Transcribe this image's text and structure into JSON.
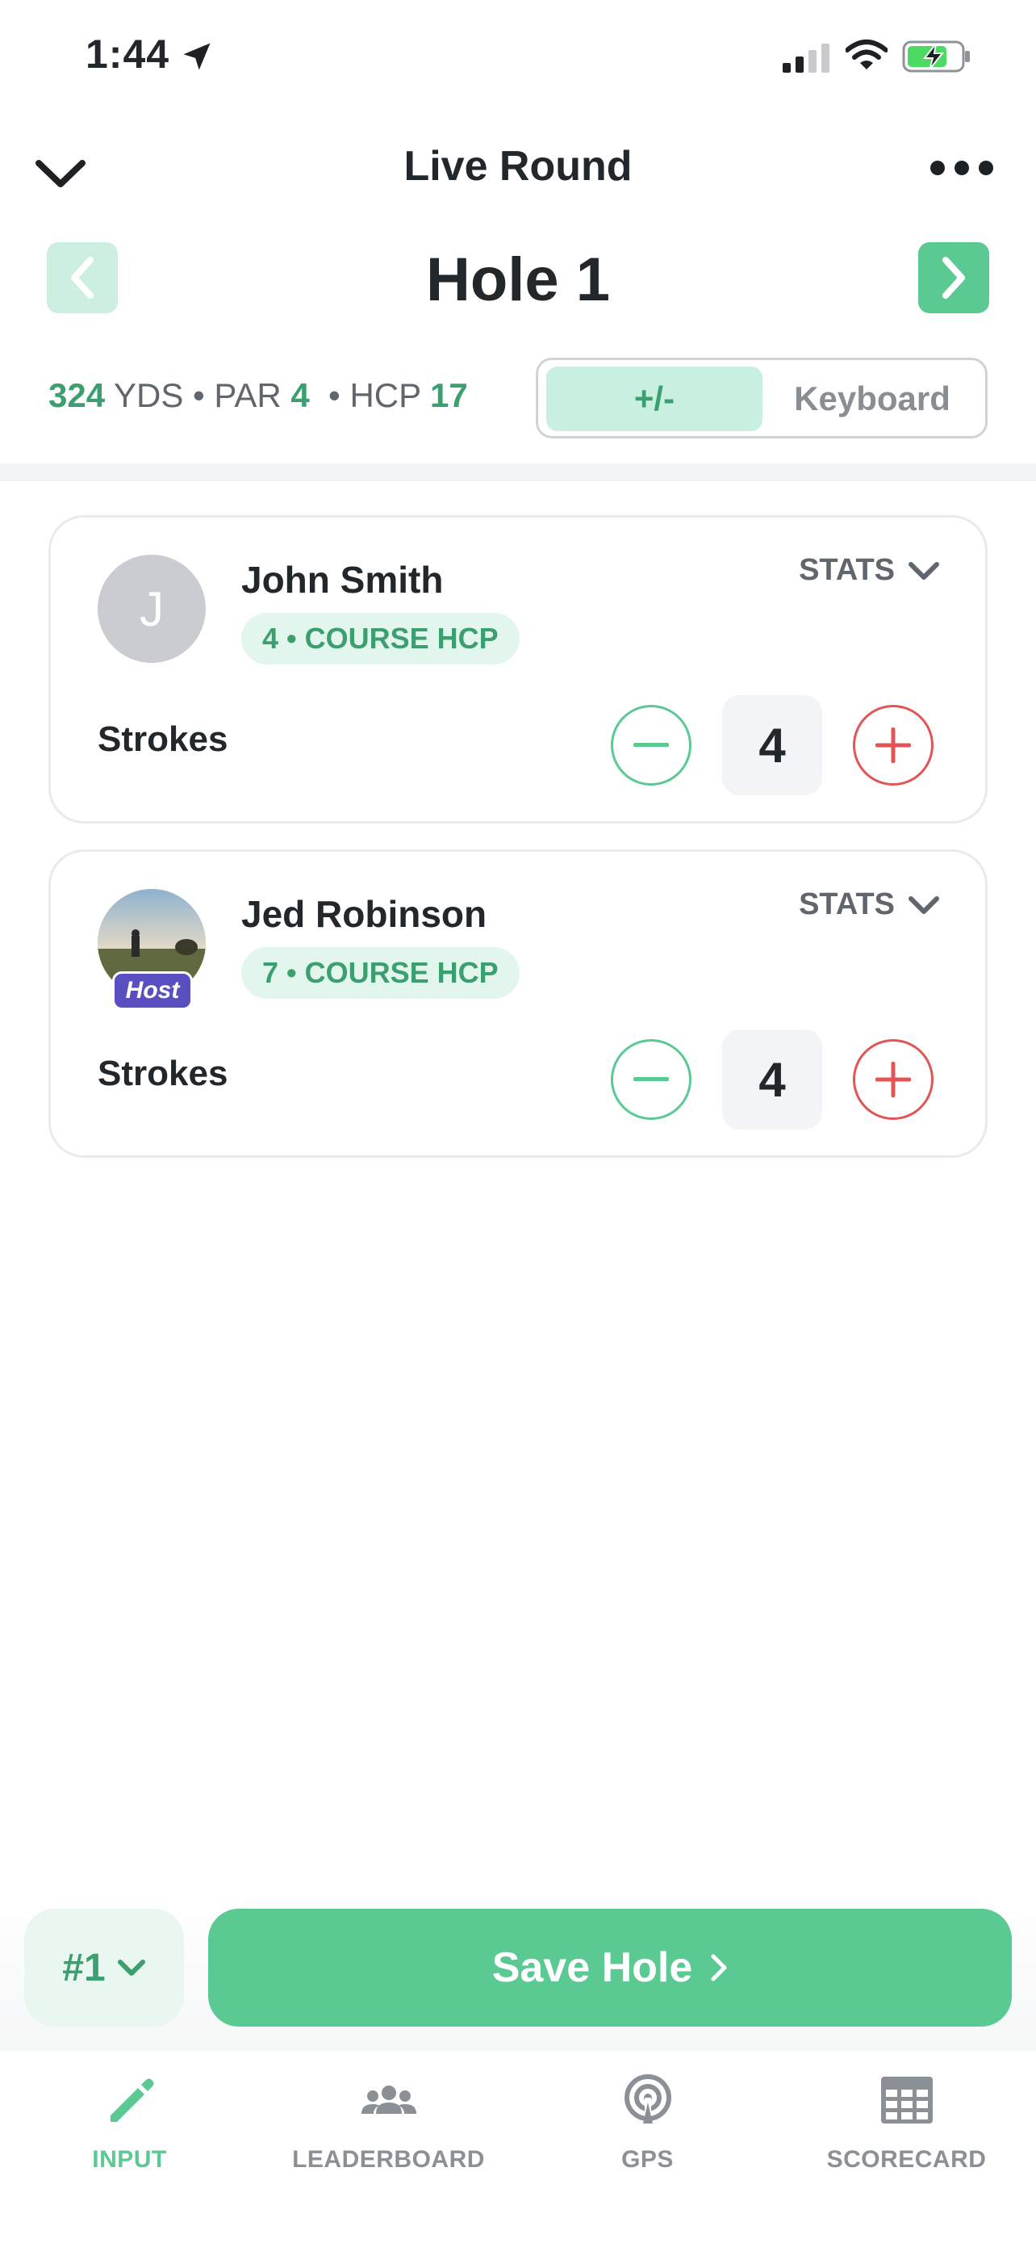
{
  "status_bar": {
    "time": "1:44"
  },
  "header": {
    "title": "Live Round"
  },
  "hole": {
    "title": "Hole 1",
    "yards": "324",
    "yards_unit": "YDS",
    "par_label": "PAR",
    "par": "4",
    "hcp_label": "HCP",
    "hcp": "17",
    "separator": "•"
  },
  "input_mode": {
    "options": [
      "+/-",
      "Keyboard"
    ],
    "selected": "+/-"
  },
  "players": [
    {
      "initial": "J",
      "name": "John Smith",
      "hcp_badge": "4 • COURSE HCP",
      "stats_label": "STATS",
      "strokes_label": "Strokes",
      "strokes": "4"
    },
    {
      "name": "Jed Robinson",
      "host_label": "Host",
      "hcp_badge": "7 • COURSE HCP",
      "stats_label": "STATS",
      "strokes_label": "Strokes",
      "strokes": "4"
    }
  ],
  "actions": {
    "hole_selector": "#1",
    "save_label": "Save Hole"
  },
  "tabs": [
    {
      "label": "INPUT",
      "icon": "pencil-icon",
      "active": true
    },
    {
      "label": "LEADERBOARD",
      "icon": "group-icon",
      "active": false
    },
    {
      "label": "GPS",
      "icon": "gps-icon",
      "active": false
    },
    {
      "label": "SCORECARD",
      "icon": "scorecard-icon",
      "active": false
    }
  ],
  "colors": {
    "accent": "#5bc992",
    "accent_dark": "#3c9f6f",
    "danger": "#e25555",
    "host": "#5a4fc0"
  }
}
